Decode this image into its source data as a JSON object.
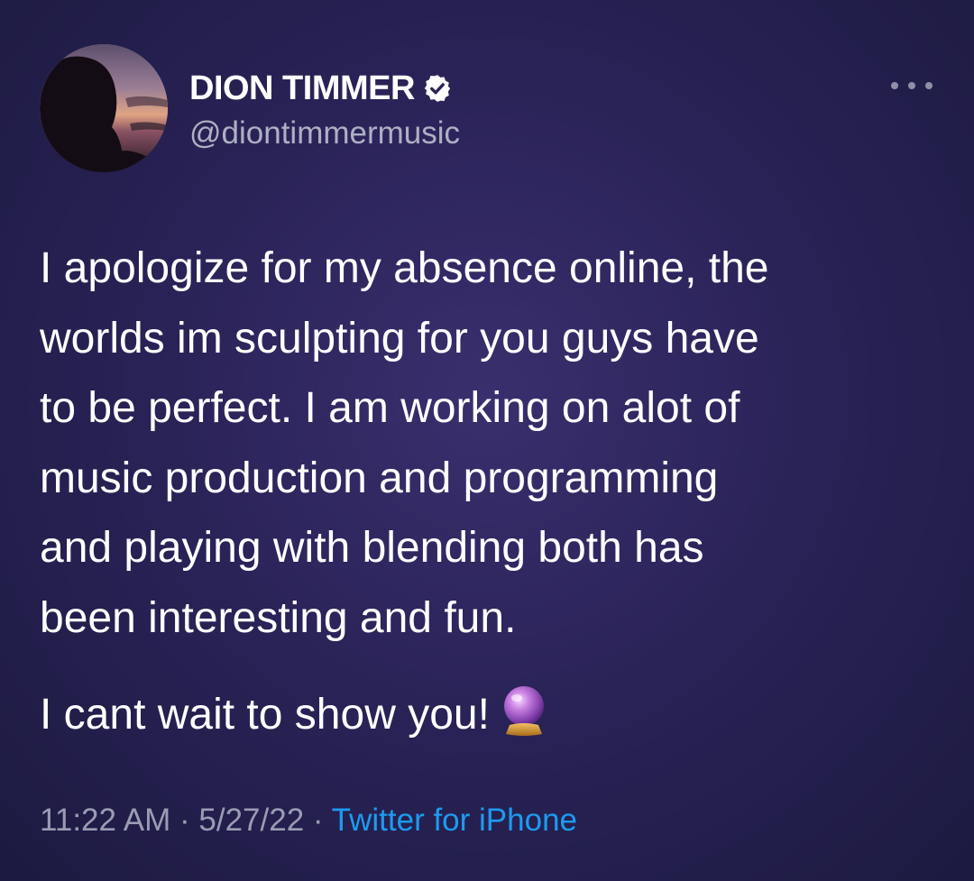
{
  "author": {
    "display_name": "DION TIMMER",
    "handle": "@diontimmermusic",
    "verified": true
  },
  "tweet": {
    "lines": [
      "I apologize for my absence online, the",
      "worlds im sculpting for you guys have",
      "to be perfect. I am working on alot of",
      "music production and programming",
      "and playing with blending both has",
      "been interesting and fun."
    ],
    "closing_line": "I cant wait to show you!",
    "emoji": "crystal-ball-icon"
  },
  "meta": {
    "time": "11:22 AM",
    "separator": " · ",
    "date": "5/27/22",
    "source": "Twitter for iPhone"
  },
  "colors": {
    "background": "#2a2358",
    "handle": "#aeb0c4",
    "meta": "#9a9cb4",
    "link": "#1d9bf0"
  }
}
